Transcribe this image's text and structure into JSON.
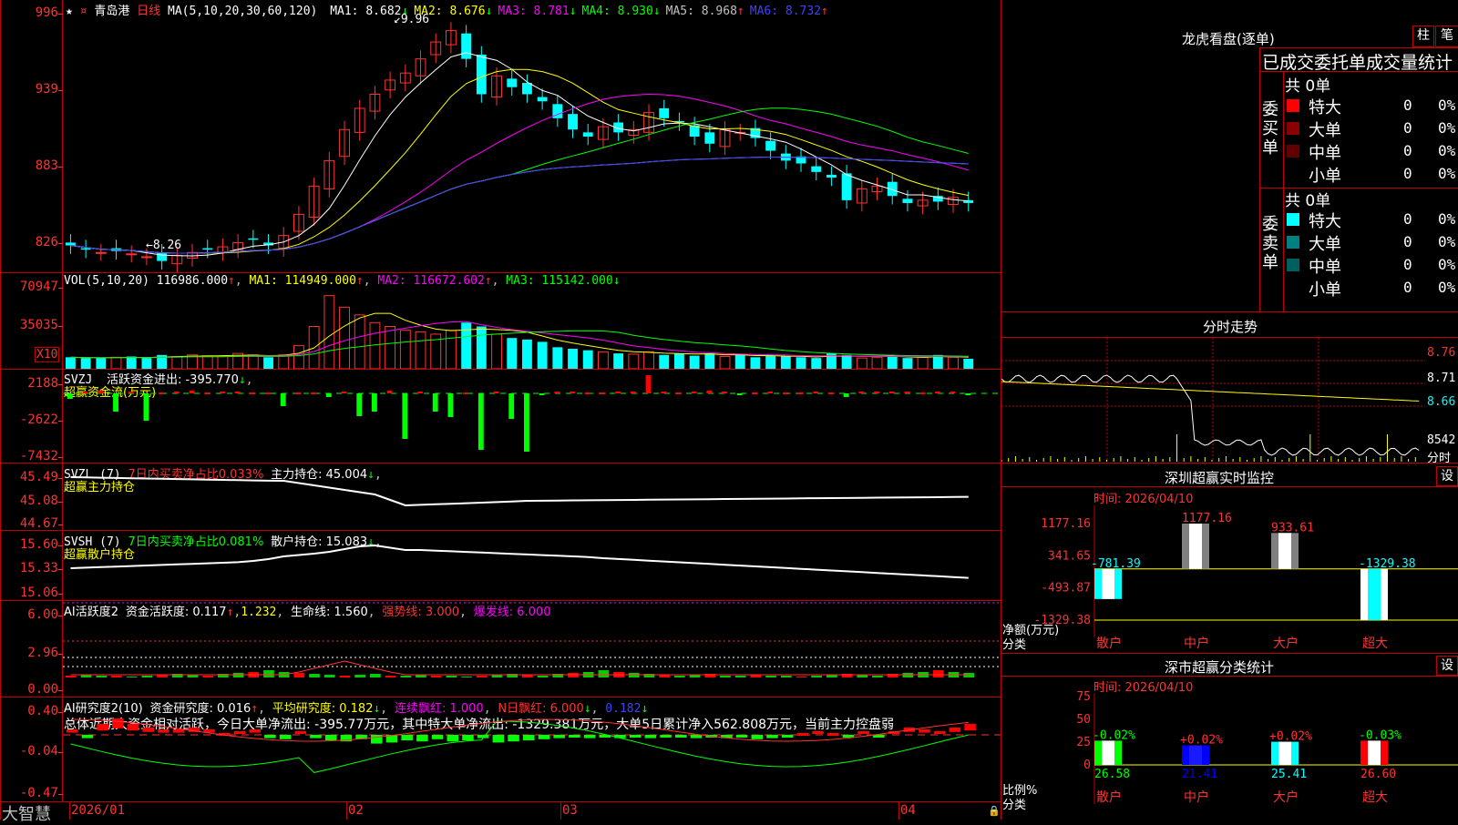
{
  "main_chart": {
    "star": "★",
    "stock_name": "青岛港",
    "period": "日线",
    "ma_spec": "MA(5,10,20,30,60,120)",
    "ma_values": [
      {
        "label": "MA1:",
        "value": "8.682",
        "arrow": "↓",
        "color": "#ffffff"
      },
      {
        "label": "MA2:",
        "value": "8.676",
        "arrow": "↓",
        "color": "#ffff00"
      },
      {
        "label": "MA3:",
        "value": "8.781",
        "arrow": "↓",
        "color": "#ff00ff"
      },
      {
        "label": "MA4:",
        "value": "8.930",
        "arrow": "↓",
        "color": "#00ff00"
      },
      {
        "label": "MA5:",
        "value": "8.968",
        "arrow": "↑",
        "color": "#c0c0c0"
      },
      {
        "label": "MA6:",
        "value": "8.732",
        "arrow": "↑",
        "color": "#4040ff"
      }
    ],
    "y_ticks": [
      "996",
      "939",
      "883",
      "826"
    ],
    "high_mark": "9.96",
    "low_mark": "8.26"
  },
  "vol_panel": {
    "title": "VOL(5,10,20)",
    "value": "116986.000",
    "ma1": "MA1: 114949.000",
    "ma2": "MA2: 116672.602",
    "ma3": "MA3: 115142.000",
    "y_ticks": [
      "70947",
      "35035"
    ],
    "multiplier": "X10"
  },
  "svzj_panel": {
    "title": "SVZJ",
    "line1": "活跃资金进出: -395.770",
    "subtitle": "超赢资金流(万元)",
    "y_ticks": [
      "2188",
      "-2622",
      "-7432"
    ]
  },
  "svzl_panel": {
    "title": "SVZL (7)",
    "ratio": "7日内买卖净占比0.033%",
    "hold": "主力持仓: 45.004",
    "subtitle": "超赢主力持仓",
    "y_ticks": [
      "45.49",
      "45.08",
      "44.67"
    ]
  },
  "svsh_panel": {
    "title": "SVSH (7)",
    "ratio": "7日内买卖净占比0.081%",
    "hold": "散户持仓: 15.083",
    "subtitle": "超赢散户持仓",
    "y_ticks": [
      "15.60",
      "15.33",
      "15.06"
    ]
  },
  "ai_active": {
    "title": "AI活跃度2",
    "text1": "资金活跃度: 0.117",
    "text2": "1.232",
    "text3": "生命线: 1.560",
    "text4": "强势线: 3.000",
    "text5": "爆发线: 6.000",
    "y_ticks": [
      "6.00",
      "2.96",
      "0.00"
    ]
  },
  "ai_research": {
    "title": "AI研究度2(10)",
    "text1": "资金研究度: 0.016",
    "text2": "平均研究度: 0.182",
    "text3": "连续飘红: 1.000",
    "text4": "N日飘红: 6.000",
    "text5": "0.182",
    "summary": "总体近期大资金相对活跃，今日大单净流出: -395.77万元，其中特大单净流出: -1329.381万元，大单5日累计净入562.808万元，当前主力控盘弱",
    "y_ticks": [
      "0.40",
      "-0.04",
      "-0.47"
    ]
  },
  "x_axis": [
    "2026/01",
    "02",
    "03",
    "04"
  ],
  "brand": "大智慧",
  "dragon_tiger": {
    "title": "龙虎看盘(逐单)",
    "btn_bar": "柱",
    "btn_pen": "笔",
    "header": "已成交委托单成交量统计",
    "buy_label": "委买单",
    "sell_label": "委卖单",
    "buy_total": "共 0单",
    "sell_total": "共 0单",
    "buy_rows": [
      {
        "name": "特大",
        "count": "0",
        "pct": "0%",
        "color": "#ff0000"
      },
      {
        "name": "大单",
        "count": "0",
        "pct": "0%",
        "color": "#8b0000"
      },
      {
        "name": "中单",
        "count": "0",
        "pct": "0%",
        "color": "#600000"
      },
      {
        "name": "小单",
        "count": "0",
        "pct": "0%",
        "color": ""
      }
    ],
    "sell_rows": [
      {
        "name": "特大",
        "count": "0",
        "pct": "0%",
        "color": "#00ffff"
      },
      {
        "name": "大单",
        "count": "0",
        "pct": "0%",
        "color": "#008080"
      },
      {
        "name": "中单",
        "count": "0",
        "pct": "0%",
        "color": "#006060"
      },
      {
        "name": "小单",
        "count": "0",
        "pct": "0%",
        "color": ""
      }
    ]
  },
  "intraday": {
    "title": "分时走势",
    "y_ticks": [
      "8.76",
      "8.71",
      "8.66"
    ],
    "vol_label": "8542",
    "unit": "分时"
  },
  "sz_monitor": {
    "title": "深圳超赢实时监控",
    "settings": "设",
    "time": "时间: 2026/04/10",
    "y_ticks": [
      "1177.16",
      "341.65",
      "-493.87",
      "-1329.38"
    ],
    "y_unit": "净额(万元)",
    "x_unit": "分类",
    "categories": [
      "散户",
      "中户",
      "大户",
      "超大"
    ],
    "values": [
      -781.39,
      1177.16,
      933.61,
      -1329.38
    ],
    "value_labels": [
      "-781.39",
      "1177.16",
      "933.61",
      "-1329.38"
    ]
  },
  "sz_stats": {
    "title": "深市超赢分类统计",
    "settings": "设",
    "time": "时间: 2026/04/10",
    "y_ticks": [
      "75",
      "50",
      "25",
      "0"
    ],
    "y_unit": "比例%",
    "x_unit": "分类",
    "categories": [
      "散户",
      "中户",
      "大户",
      "超大"
    ],
    "values": [
      26.58,
      21.41,
      25.41,
      26.6
    ],
    "value_labels": [
      "26.58",
      "21.41",
      "25.41",
      "26.60"
    ],
    "change_labels": [
      "-0.02%",
      "+0.02%",
      "+0.02%",
      "-0.03%"
    ]
  }
}
